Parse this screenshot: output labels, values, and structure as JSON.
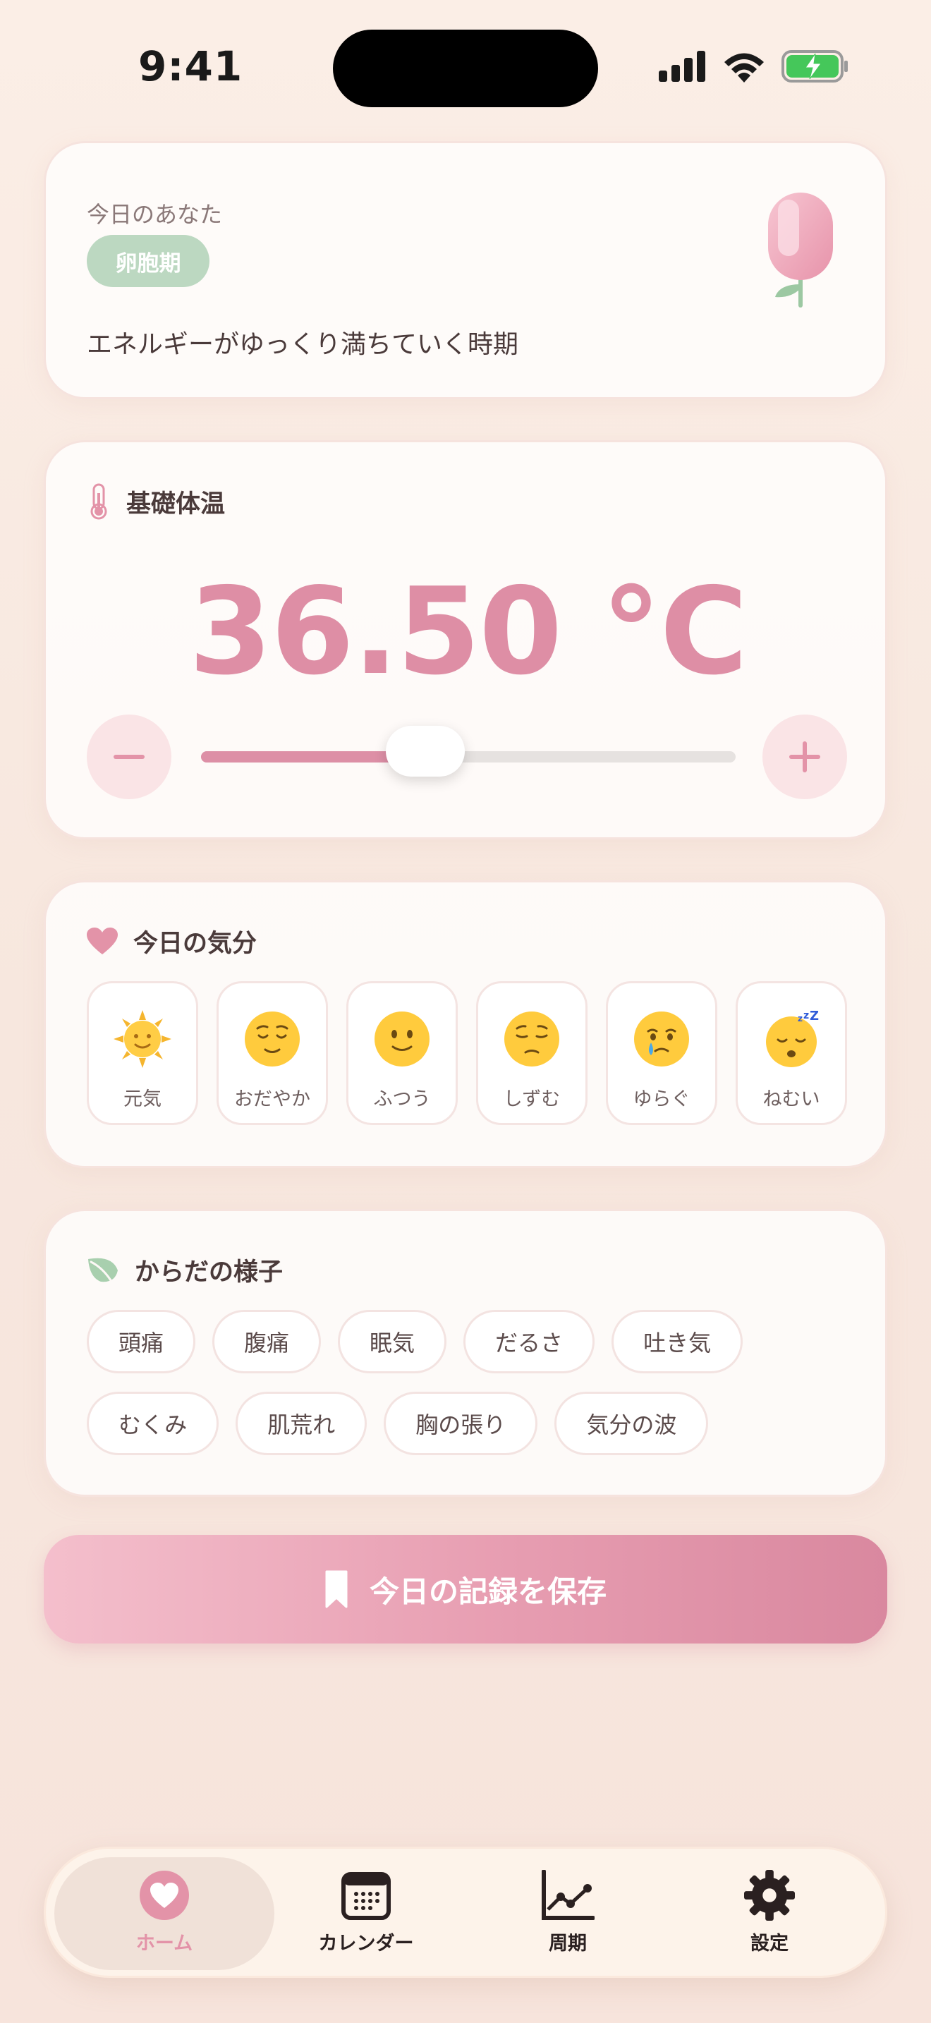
{
  "status": {
    "time": "9:41"
  },
  "phase": {
    "heading": "今日のあなた",
    "badge": "卵胞期",
    "description": "エネルギーがゆっくり満ちていく時期"
  },
  "temperature": {
    "title": "基礎体温",
    "value": "36.50 °C",
    "slider_fraction": 0.42
  },
  "mood": {
    "title": "今日の気分",
    "items": [
      {
        "icon": "sun-face-icon",
        "label": "元気"
      },
      {
        "icon": "relieved-face-icon",
        "label": "おだやか"
      },
      {
        "icon": "smiling-face-icon",
        "label": "ふつう"
      },
      {
        "icon": "pensive-face-icon",
        "label": "しずむ"
      },
      {
        "icon": "crying-face-icon",
        "label": "ゆらぐ"
      },
      {
        "icon": "sleeping-face-icon",
        "label": "ねむい"
      }
    ]
  },
  "body": {
    "title": "からだの様子",
    "tags": [
      "頭痛",
      "腹痛",
      "眠気",
      "だるさ",
      "吐き気",
      "むくみ",
      "肌荒れ",
      "胸の張り",
      "気分の波"
    ]
  },
  "save": {
    "label": "今日の記録を保存"
  },
  "tabs": [
    {
      "label": "ホーム",
      "icon": "heart-icon",
      "active": true
    },
    {
      "label": "カレンダー",
      "icon": "calendar-icon",
      "active": false
    },
    {
      "label": "周期",
      "icon": "chart-icon",
      "active": false
    },
    {
      "label": "設定",
      "icon": "gear-icon",
      "active": false
    }
  ],
  "colors": {
    "accent": "#de8ea5",
    "badge_green": "#bcd8c1",
    "leaf_green": "#9cc8a2"
  }
}
